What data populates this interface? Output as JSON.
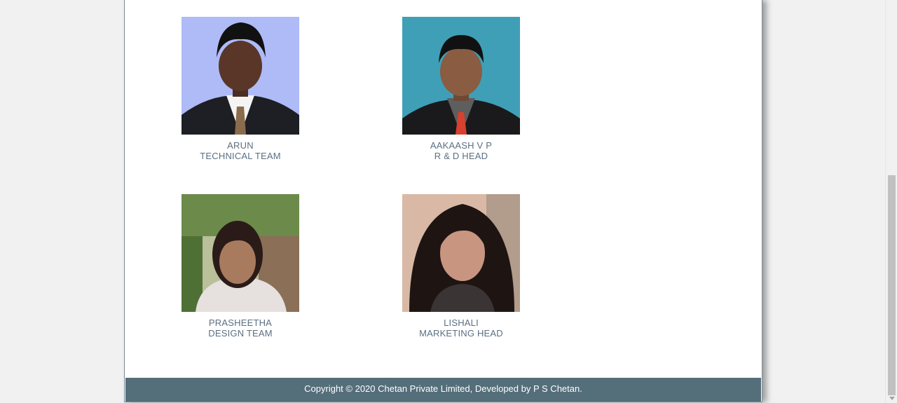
{
  "team": [
    {
      "name": "ARUN",
      "role": "TECHNICAL TEAM",
      "photo_bg": "#aebbf7"
    },
    {
      "name": "AAKAASH V P",
      "role": "R & D HEAD",
      "photo_bg": "#3f9fb7"
    },
    {
      "name": "PRASHEETHA",
      "role": "DESIGN TEAM",
      "photo_bg": "#8d9a6a"
    },
    {
      "name": "LISHALI",
      "role": "MARKETING HEAD",
      "photo_bg": "#d9b9a5"
    }
  ],
  "footer": {
    "text": "Copyright © 2020 Chetan Private Limited, Developed by P S Chetan.",
    "bg": "#546e7a"
  }
}
